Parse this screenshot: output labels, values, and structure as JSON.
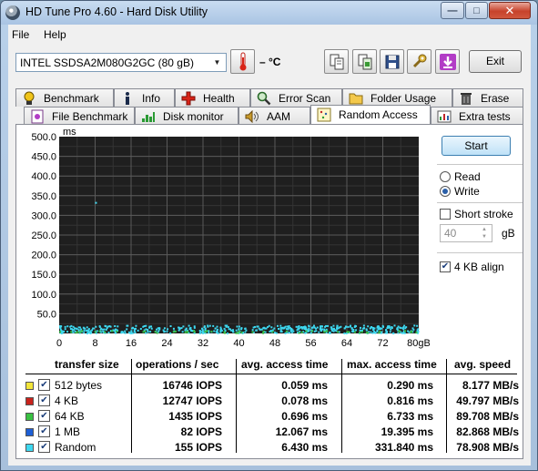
{
  "window": {
    "title": "HD Tune Pro 4.60 - Hard Disk Utility"
  },
  "menu": {
    "file": "File",
    "help": "Help"
  },
  "toolbar": {
    "drive": "INTEL SSDSA2M080G2GC    (80 gB)",
    "temperature": "– °C",
    "exit_label": "Exit"
  },
  "tabs_top": [
    {
      "label": "Benchmark",
      "icon": "benchmark-icon"
    },
    {
      "label": "Info",
      "icon": "info-icon"
    },
    {
      "label": "Health",
      "icon": "health-icon"
    },
    {
      "label": "Error Scan",
      "icon": "error-scan-icon"
    },
    {
      "label": "Folder Usage",
      "icon": "folder-icon"
    },
    {
      "label": "Erase",
      "icon": "trash-icon"
    }
  ],
  "tabs_bottom": [
    {
      "label": "File Benchmark",
      "icon": "file-benchmark-icon"
    },
    {
      "label": "Disk monitor",
      "icon": "disk-monitor-icon"
    },
    {
      "label": "AAM",
      "icon": "speaker-icon"
    },
    {
      "label": "Random Access",
      "icon": "random-access-icon",
      "active": true
    },
    {
      "label": "Extra tests",
      "icon": "extra-tests-icon"
    }
  ],
  "side": {
    "start_label": "Start",
    "read_label": "Read",
    "write_label": "Write",
    "selected_mode": "Write",
    "short_stroke_label": "Short stroke",
    "short_stroke_checked": false,
    "stroke_value": "40",
    "stroke_unit": "gB",
    "align_label": "4 KB align",
    "align_checked": true
  },
  "chart_data": {
    "type": "scatter",
    "ylabel": "ms",
    "ylim": [
      0,
      500
    ],
    "xlim": [
      0,
      80
    ],
    "yticks": [
      "500.0",
      "450.0",
      "400.0",
      "350.0",
      "300.0",
      "250.0",
      "200.0",
      "150.0",
      "100.0",
      "50.0"
    ],
    "xticks": [
      "0",
      "8",
      "16",
      "24",
      "32",
      "40",
      "48",
      "56",
      "64",
      "72",
      "80gB"
    ],
    "grid": true,
    "background": "#1f1f1f",
    "colors": {
      "512 bytes": "#f2e53a",
      "4 KB": "#c9231c",
      "64 KB": "#39c142",
      "1 MB": "#1d5fd6",
      "Random": "#3ed8f0"
    },
    "series": [
      {
        "name": "Random",
        "y_range_ms": [
          0,
          20
        ],
        "outliers": [
          {
            "x": 8,
            "y": 331.8
          }
        ]
      },
      {
        "name": "64 KB",
        "y_range_ms": [
          0.7,
          6.7
        ]
      }
    ]
  },
  "results": {
    "headers": [
      "transfer size",
      "operations / sec",
      "avg. access time",
      "max. access time",
      "avg. speed"
    ],
    "rows": [
      {
        "label": "512 bytes",
        "color": "#f2e53a",
        "ops": "16746 IOPS",
        "avg": "0.059 ms",
        "max": "0.290 ms",
        "speed": "8.177 MB/s"
      },
      {
        "label": "4 KB",
        "color": "#c9231c",
        "ops": "12747 IOPS",
        "avg": "0.078 ms",
        "max": "0.816 ms",
        "speed": "49.797 MB/s"
      },
      {
        "label": "64 KB",
        "color": "#39c142",
        "ops": "1435 IOPS",
        "avg": "0.696 ms",
        "max": "6.733 ms",
        "speed": "89.708 MB/s"
      },
      {
        "label": "1 MB",
        "color": "#1d5fd6",
        "ops": "82 IOPS",
        "avg": "12.067 ms",
        "max": "19.395 ms",
        "speed": "82.868 MB/s"
      },
      {
        "label": "Random",
        "color": "#3ed8f0",
        "ops": "155 IOPS",
        "avg": "6.430 ms",
        "max": "331.840 ms",
        "speed": "78.908 MB/s"
      }
    ]
  }
}
